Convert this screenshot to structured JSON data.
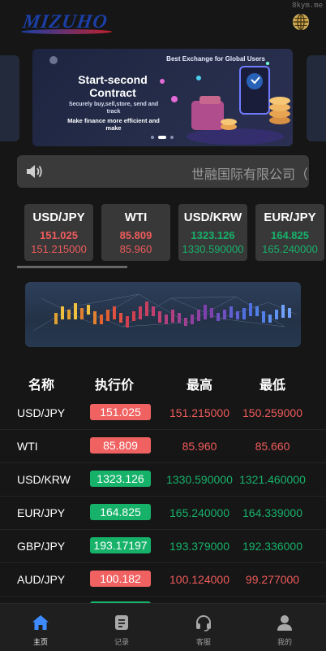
{
  "header": {
    "logo_text": "MIZUHO",
    "watermark": "8kym.me",
    "lang_icon": "globe-icon"
  },
  "banner": {
    "tagline": "Best Exchange for Global Users",
    "title_line1": "Start-second",
    "title_line2": "Contract",
    "subtitle": "Securely buy,sell,store, send and track",
    "subtitle2": "Make finance more efficient and make",
    "active_slide_index": 1,
    "slide_count": 3
  },
  "notice": {
    "icon": "speaker-icon",
    "text": "世融国际有限公司（「世"
  },
  "tickers": [
    {
      "symbol": "USD/JPY",
      "price": "151.025",
      "high": "151.215000",
      "trend": "down"
    },
    {
      "symbol": "WTI",
      "price": "85.809",
      "high": "85.960",
      "trend": "down"
    },
    {
      "symbol": "USD/KRW",
      "price": "1323.126",
      "high": "1330.590000",
      "trend": "up"
    },
    {
      "symbol": "EUR/JPY",
      "price": "164.825",
      "high": "165.240000",
      "trend": "up"
    }
  ],
  "table": {
    "headers": {
      "name": "名称",
      "price": "执行价",
      "high": "最高",
      "low": "最低"
    },
    "rows": [
      {
        "name": "USD/JPY",
        "price": "151.025",
        "high": "151.215000",
        "low": "150.259000",
        "trend": "down"
      },
      {
        "name": "WTI",
        "price": "85.809",
        "high": "85.960",
        "low": "85.660",
        "trend": "down"
      },
      {
        "name": "USD/KRW",
        "price": "1323.126",
        "high": "1330.590000",
        "low": "1321.460000",
        "trend": "up"
      },
      {
        "name": "EUR/JPY",
        "price": "164.825",
        "high": "165.240000",
        "low": "164.339000",
        "trend": "up"
      },
      {
        "name": "GBP/JPY",
        "price": "193.17197",
        "high": "193.379000",
        "low": "192.336000",
        "trend": "up"
      },
      {
        "name": "AUD/JPY",
        "price": "100.182",
        "high": "100.124000",
        "low": "99.277000",
        "trend": "down"
      }
    ]
  },
  "tabbar": {
    "tabs": [
      {
        "label": "主页",
        "icon": "home-icon",
        "active": true
      },
      {
        "label": "记录",
        "icon": "record-icon",
        "active": false
      },
      {
        "label": "客服",
        "icon": "headset-icon",
        "active": false
      },
      {
        "label": "我的",
        "icon": "user-icon",
        "active": false
      }
    ]
  },
  "colors": {
    "up": "#17b26a",
    "down": "#ef5b5b",
    "active_tab": "#3d8bff",
    "background": "#161616"
  }
}
